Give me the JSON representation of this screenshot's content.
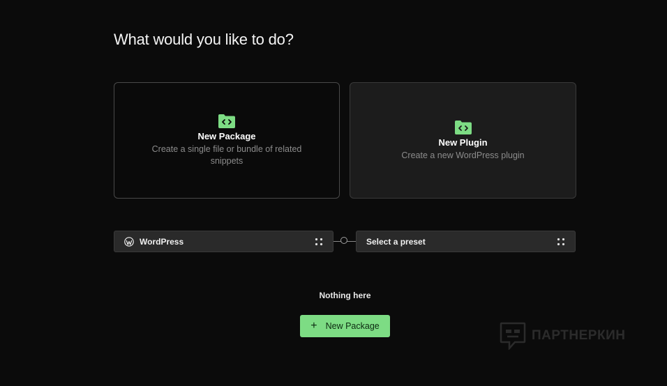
{
  "page": {
    "heading": "What would you like to do?"
  },
  "cards": {
    "package": {
      "icon": "folder-code-icon",
      "title": "New Package",
      "description": "Create a single file or bundle of related snippets"
    },
    "plugin": {
      "icon": "folder-code-icon",
      "title": "New Plugin",
      "description": "Create a new WordPress plugin"
    }
  },
  "selectors": {
    "platform": {
      "icon": "wordpress-icon",
      "label": "WordPress"
    },
    "preset": {
      "label": "Select a preset"
    }
  },
  "empty_state": {
    "message": "Nothing here",
    "button_label": "New Package",
    "button_icon": "plus-icon"
  },
  "watermark": {
    "text": "ПАРТНЕРКИН"
  },
  "colors": {
    "accent": "#7ddc84",
    "background": "#0b0b0b",
    "card_alt": "#1c1c1c"
  }
}
